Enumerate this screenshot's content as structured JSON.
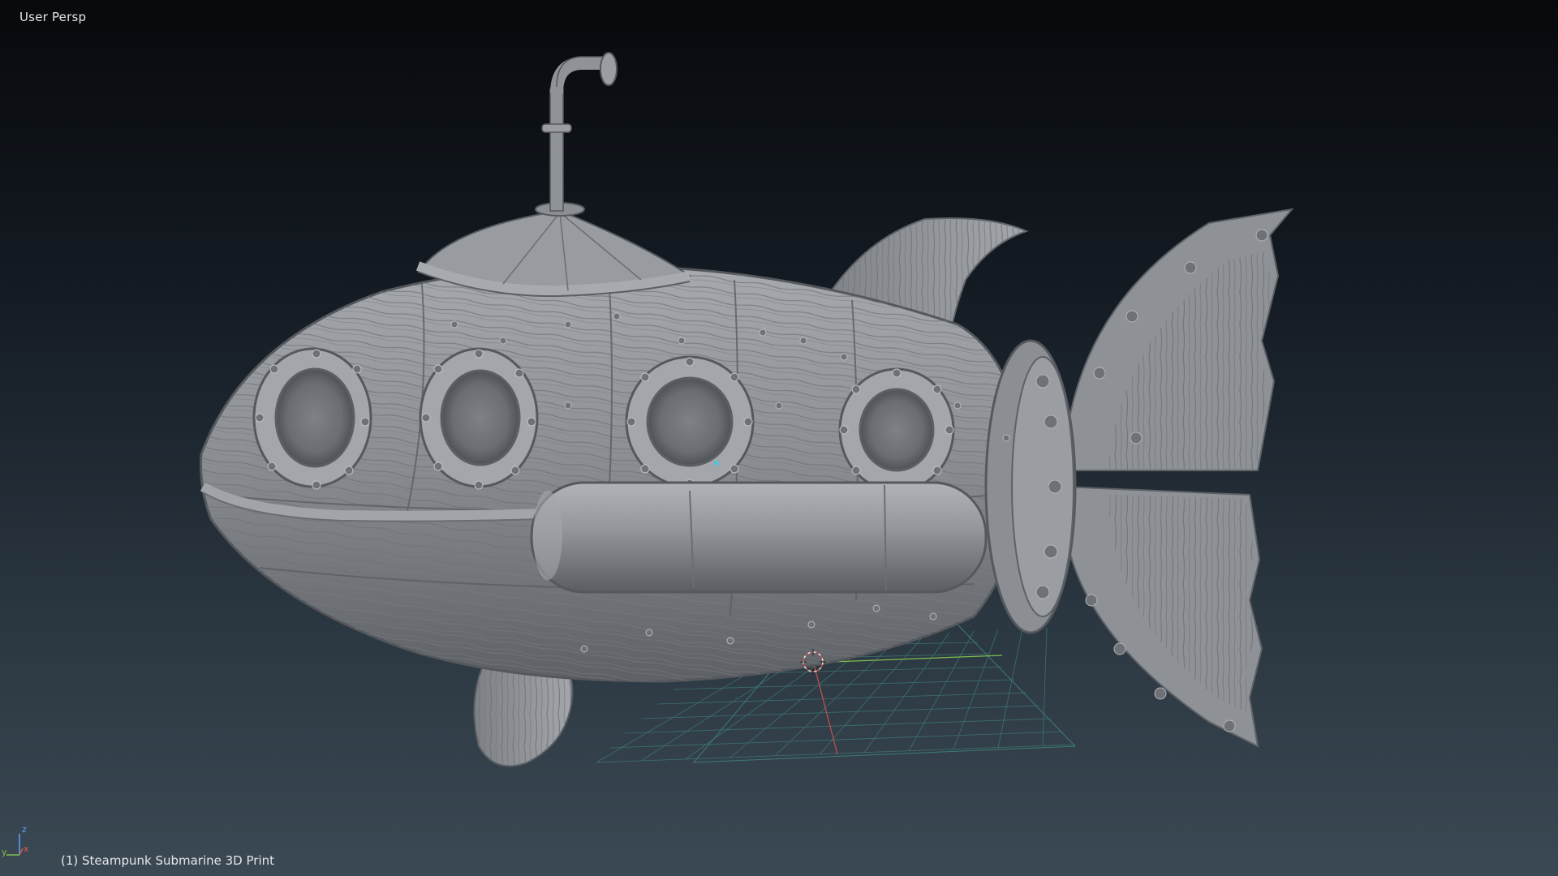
{
  "viewport": {
    "view_label": "User Persp",
    "object_label": "(1) Steampunk Submarine 3D Print",
    "background_top": "#07090c",
    "background_bottom": "#3b4954"
  },
  "model": {
    "name": "Steampunk Submarine",
    "material_color": "#8a8d92",
    "shadow_color": "#55585d",
    "highlight_color": "#b4b7bb"
  },
  "grid": {
    "line_color": "#3e7a78",
    "x_axis_color": "#c0504d",
    "y_axis_color": "#7fbf4f"
  },
  "axis_gizmo": {
    "z_label": "z",
    "y_label": "y",
    "x_label": "x",
    "z_color": "#5aa0ff",
    "y_color": "#7fbf4f",
    "x_color": "#d9584a"
  }
}
